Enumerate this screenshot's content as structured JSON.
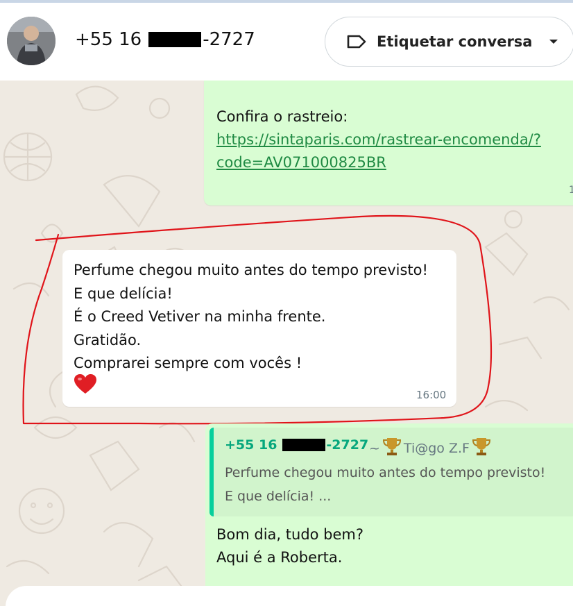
{
  "header": {
    "phone_prefix": "+55 16",
    "phone_suffix": "-2727",
    "tag_button_label": "Etiquetar conversa"
  },
  "messages": {
    "outgoing_1": {
      "text": "Confira o rastreio:",
      "link_line1": "https://sintaparis.com/rastrear-encomenda/?",
      "link_line2": "code=AV071000825BR",
      "time_partial": "1"
    },
    "incoming": {
      "lines": [
        "Perfume chegou muito antes do tempo previsto!",
        "E que delícia!",
        "É o Creed Vetiver na minha frente.",
        "Gratidão.",
        "Comprarei sempre com vocês !"
      ],
      "emoji": "❤️",
      "time": "16:00"
    },
    "outgoing_2": {
      "quote_author_prefix": "+55 16",
      "quote_author_suffix": "-2727",
      "quote_name_prefix": "~",
      "quote_name": "Ti@go Z.F",
      "quote_line1": "Perfume chegou muito antes do tempo previsto!",
      "quote_line2": "E que delícia! ...",
      "lines": [
        "Bom dia, tudo bem?",
        "Aqui é a Roberta."
      ]
    }
  },
  "colors": {
    "outgoing_bubble": "#d9fdd3",
    "incoming_bubble": "#ffffff",
    "link": "#1f8a43",
    "quote_accent": "#06cf9c",
    "annotation": "#e0141a",
    "chat_background": "#efeae2"
  },
  "icons": {
    "tag": "tag-icon",
    "caret": "caret-down-icon",
    "trophy": "trophy-icon"
  }
}
